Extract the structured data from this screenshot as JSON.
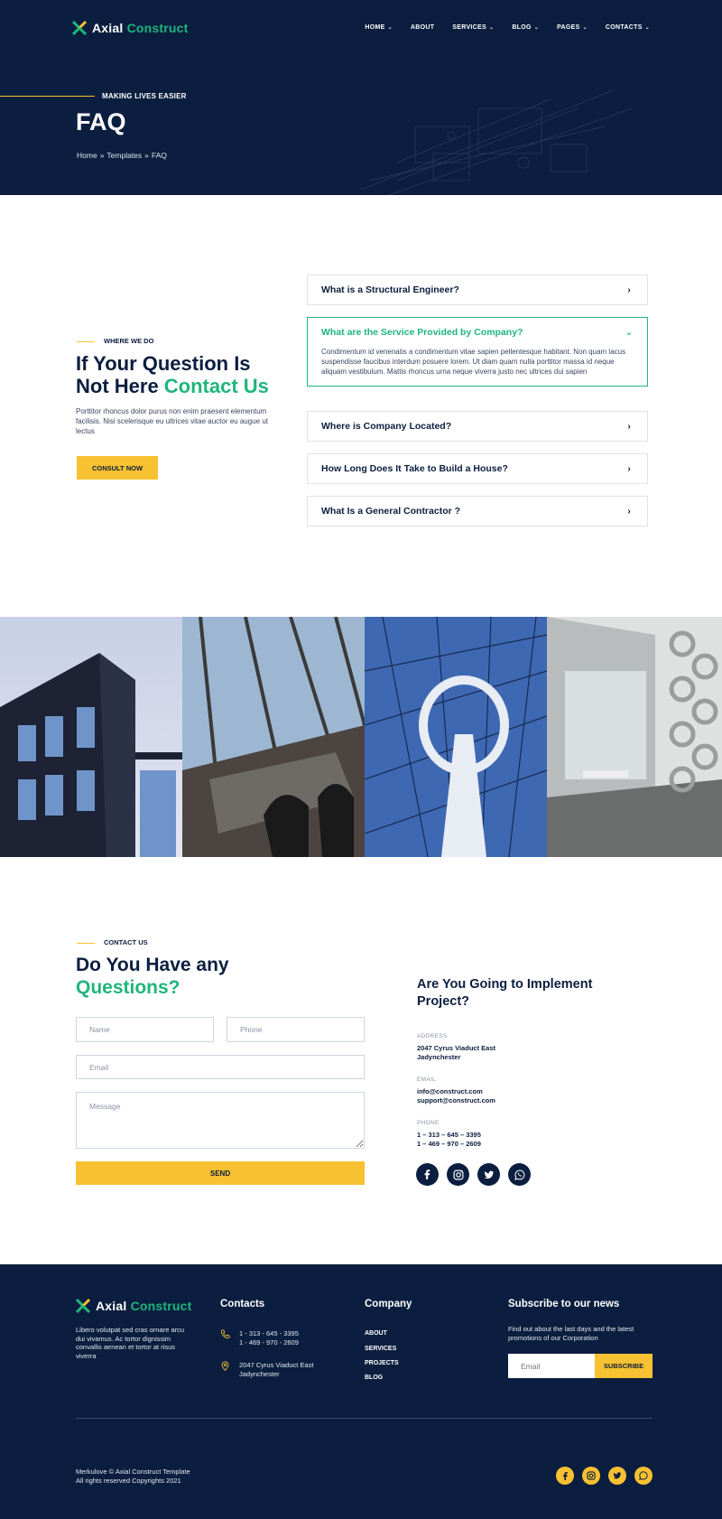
{
  "colors": {
    "navy": "#0b1e3f",
    "green": "#1fb57c",
    "yellow": "#f7c131"
  },
  "header": {
    "logo": {
      "word1": "Axial",
      "word2": "Construct"
    },
    "nav": [
      {
        "label": "HOME",
        "caret": true
      },
      {
        "label": "ABOUT",
        "caret": false
      },
      {
        "label": "SERVICES",
        "caret": true
      },
      {
        "label": "BLOG",
        "caret": true
      },
      {
        "label": "PAGES",
        "caret": true
      },
      {
        "label": "CONTACTS",
        "caret": true
      }
    ]
  },
  "hero": {
    "eyebrow": "MAKING LIVES EASIER",
    "title": "FAQ",
    "breadcrumb": [
      "Home",
      "»",
      "Templates",
      "»",
      "FAQ"
    ]
  },
  "faq": {
    "eyebrow": "WHERE WE DO",
    "heading_line1": "If Your Question Is",
    "heading_line2": "Not Here ",
    "heading_accent": "Contact Us",
    "text": "Porttitor rhoncus dolor purus non enim praesent elementum facilisis. Nisi scelerisque eu ultrices vitae auctor eu augue ut lectus",
    "button": "CONSULT NOW",
    "items": [
      {
        "q": "What is a Structural Engineer?",
        "open": false
      },
      {
        "q": "What are the Service Provided by Company?",
        "open": true,
        "a": "Condimentum id venenatis a condimentum vitae sapien pellentesque habitant. Non quam lacus suspendisse faucibus interdum posuere lorem. Ut diam quam nulla porttitor massa id neque aliquam vestibulum. Mattis rhoncus urna neque viverra justo nec ultrices dui sapien"
      },
      {
        "q": "Where is Company Located?",
        "open": false
      },
      {
        "q": "How Long Does It Take to Build a House?",
        "open": false
      },
      {
        "q": "What Is a General Contractor ?",
        "open": false
      }
    ]
  },
  "contact": {
    "eyebrow": "CONTACT US",
    "heading_line1": "Do You Have any",
    "heading_accent": "Questions?",
    "placeholders": {
      "name": "Name",
      "phone": "Phone",
      "email": "Email",
      "message": "Message"
    },
    "send": "SEND",
    "info_heading": "Are You Going to Implement Project?",
    "address_label": "ADDRESS",
    "address_lines": [
      "2047 Cyrus Viaduct East",
      "Jadynchester"
    ],
    "email_label": "EMAIL",
    "email_lines": [
      "info@construct.com",
      "support@construct.com"
    ],
    "phone_label": "PHONE",
    "phone_lines": [
      "1 – 313 – 645 – 3395",
      "1 – 469 – 970 – 2609"
    ],
    "social": [
      "facebook-icon",
      "instagram-icon",
      "twitter-icon",
      "whatsapp-icon"
    ]
  },
  "footer": {
    "about": "Libero volutpat sed cras ornare arcu dui vivamus. Ac tortor dignissim convallis aenean et tortor at risus viverra",
    "contacts_title": "Contacts",
    "phones": [
      "1 - 313 - 645 - 3395",
      "1 - 469 - 970 - 2609"
    ],
    "address": [
      "2047 Cyrus Viaduct East",
      "Jadynchester"
    ],
    "company_title": "Company",
    "links": [
      "ABOUT",
      "SERVICES",
      "PROJECTS",
      "BLOG"
    ],
    "news_title": "Subscribe to our news",
    "news_text": "Find out about the last days and the latest promotions of our Corporation",
    "email_placeholder": "Email",
    "subscribe": "SUBSCRIBE",
    "copyright_line1": "Merkulove © Axial Construct Template",
    "copyright_line2": "All rights reserved Copyrights 2021"
  }
}
